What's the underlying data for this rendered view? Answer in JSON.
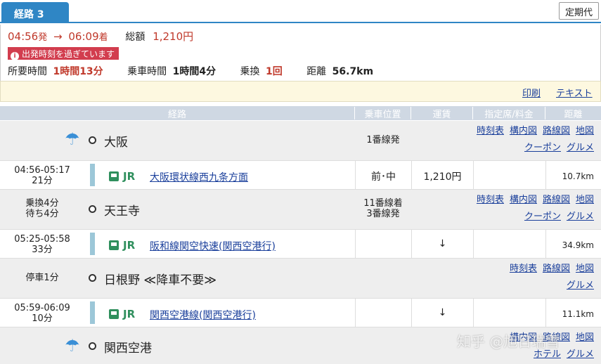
{
  "tab": {
    "label": "経路 3",
    "teiki": "定期代"
  },
  "summary": {
    "depart": "04:56",
    "depart_suffix": "発",
    "arrive": "06:09",
    "arrive_suffix": "着",
    "total_label": "総額",
    "total": "1,210円",
    "warning": "出発時刻を過ぎています",
    "duration_label": "所要時間",
    "duration": "1時間13分",
    "ride_label": "乗車時間",
    "ride": "1時間4分",
    "transfer_label": "乗換",
    "transfer": "1回",
    "distance_label": "距離",
    "distance": "56.7km"
  },
  "actions": {
    "print": "印刷",
    "text": "テキスト"
  },
  "headers": {
    "route": "経路",
    "position": "乗車位置",
    "fare": "運賃",
    "reserved": "指定席/料金",
    "distance": "距離"
  },
  "stations": [
    {
      "name": "大阪",
      "left": "",
      "platform": "1番線発",
      "links1": [
        "時刻表",
        "構内図",
        "路線図",
        "地図"
      ],
      "links2": [
        "クーポン",
        "グルメ"
      ]
    },
    {
      "name": "天王寺",
      "left": "乗換4分\n待ち4分",
      "platform": "11番線着\n3番線発",
      "links1": [
        "時刻表",
        "構内図",
        "路線図",
        "地図"
      ],
      "links2": [
        "クーポン",
        "グルメ"
      ]
    },
    {
      "name": "日根野 ≪降車不要≫",
      "left": "停車1分",
      "platform": "",
      "links1": [
        "時刻表",
        "路線図",
        "地図"
      ],
      "links2": [
        "グルメ"
      ]
    },
    {
      "name": "関西空港",
      "left": "",
      "platform": "",
      "links1": [
        "構内図",
        "路線図",
        "地図"
      ],
      "links2": [
        "ホテル",
        "グルメ"
      ]
    }
  ],
  "segments": [
    {
      "time": "04:56-05:17",
      "mins": "21分",
      "op": "JR",
      "line": "大阪環状線西九条方面",
      "position": "前･中",
      "fare": "1,210円",
      "dist": "10.7km"
    },
    {
      "time": "05:25-05:58",
      "mins": "33分",
      "op": "JR",
      "line": "阪和線関空快速(関西空港行)",
      "position": "",
      "fare": "↓",
      "dist": "34.9km"
    },
    {
      "time": "05:59-06:09",
      "mins": "10分",
      "op": "JR",
      "line": "関西空港線(関西空港行)",
      "position": "",
      "fare": "↓",
      "dist": "11.1km"
    }
  ],
  "watermark": "知乎 @旭日瑞雪",
  "colors": {
    "accent": "#2f86c5",
    "price": "#c0392b",
    "link": "#1a3f9b",
    "jr": "#2f8f5d"
  }
}
